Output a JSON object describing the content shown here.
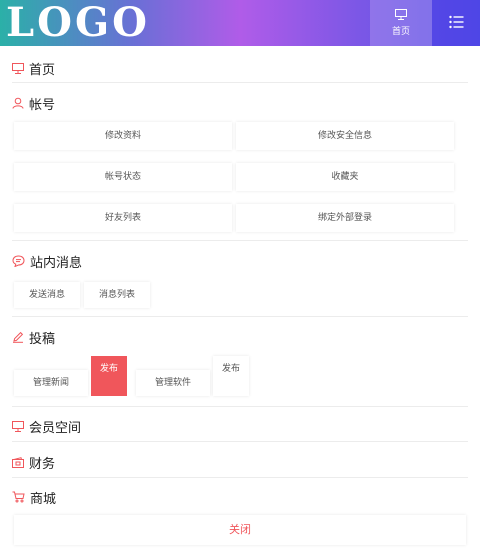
{
  "header": {
    "logo": "LOGO",
    "home_label": "首页",
    "home_icon": "monitor-icon",
    "menu_icon": "list-menu-icon"
  },
  "sections": {
    "home": {
      "title": "首页",
      "icon": "monitor-icon"
    },
    "account": {
      "title": "帐号",
      "icon": "user-icon",
      "items": [
        "修改资料",
        "修改安全信息",
        "帐号状态",
        "收藏夹",
        "好友列表",
        "绑定外部登录"
      ]
    },
    "messages": {
      "title": "站内消息",
      "icon": "chat-bubble-icon",
      "items": [
        "发送消息",
        "消息列表"
      ]
    },
    "contribute": {
      "title": "投稿",
      "icon": "pencil-icon",
      "items": [
        {
          "label": "管理新闻"
        },
        {
          "label": "发布"
        },
        {
          "label": "管理软件"
        },
        {
          "label": "发布"
        }
      ]
    },
    "member_space": {
      "title": "会员空间",
      "icon": "monitor-icon"
    },
    "finance": {
      "title": "财务",
      "icon": "wallet-icon"
    },
    "shop": {
      "title": "商城",
      "icon": "cart-icon"
    }
  },
  "close_label": "关闭",
  "colors": {
    "accent": "#f0565b",
    "gradient_start": "#2bb0a8",
    "gradient_end": "#5a52e6"
  }
}
